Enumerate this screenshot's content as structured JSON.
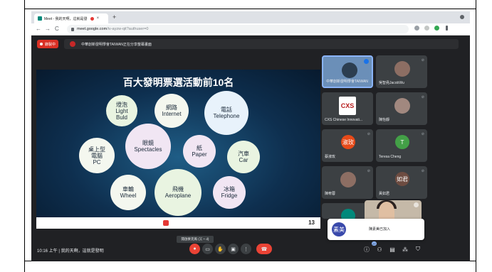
{
  "browser": {
    "tab_title": "Meet - 我的天啊，這就是發",
    "new_tab": "+",
    "back": "←",
    "forward": "→",
    "reload": "C",
    "url_host": "meet.google.com",
    "url_path": "/iv-ayzw-qit?authuser=0"
  },
  "meet": {
    "recording_label": "錄製中",
    "presenting_label": "中華創新發明學會TAIWAN正在分享螢幕畫面"
  },
  "slide": {
    "title": "百大發明票選活動前10名",
    "bubbles": [
      {
        "zh": "燈泡",
        "en1": "Light",
        "en2": "Buld"
      },
      {
        "zh": "網路",
        "en1": "Internet",
        "en2": ""
      },
      {
        "zh": "電話",
        "en1": "Telephone",
        "en2": ""
      },
      {
        "zh": "桌上型",
        "en1": "電腦",
        "en2": "PC"
      },
      {
        "zh": "眼鏡",
        "en1": "Spectacles",
        "en2": ""
      },
      {
        "zh": "紙",
        "en1": "Paper",
        "en2": ""
      },
      {
        "zh": "汽車",
        "en1": "Car",
        "en2": ""
      },
      {
        "zh": "車輪",
        "en1": "Wheel",
        "en2": ""
      },
      {
        "zh": "飛機",
        "en1": "Aeroplane",
        "en2": ""
      },
      {
        "zh": "冰箱",
        "en1": "Fridge",
        "en2": ""
      }
    ],
    "page_number": "13"
  },
  "participants": [
    {
      "name": "中華創新發明學會TAIWAN",
      "initial": ""
    },
    {
      "name": "吳智堯JacobWu",
      "initial": ""
    },
    {
      "name": "CXS Chinese Innovati...",
      "initial": "CXS"
    },
    {
      "name": "陳怡靜",
      "initial": ""
    },
    {
      "name": "蔡淑玫",
      "initial": "淑玫"
    },
    {
      "name": "Teresa Cheng",
      "initial": "T"
    },
    {
      "name": "陳宥蓉",
      "initial": ""
    },
    {
      "name": "黃如君",
      "initial": "如君"
    }
  ],
  "bottom": {
    "time_title": "10:16 上午 | 我的天啊，這就是發明",
    "tooltip": "開啟麥克風 (⌘ + d)",
    "people_count": "27"
  },
  "toast": {
    "initial": "素美",
    "message": "陳素美已加入"
  },
  "colors": {
    "meet_bg": "#202124",
    "record_red": "#d93025",
    "hangup_red": "#ea4335",
    "accent_blue": "#1a73e8"
  }
}
